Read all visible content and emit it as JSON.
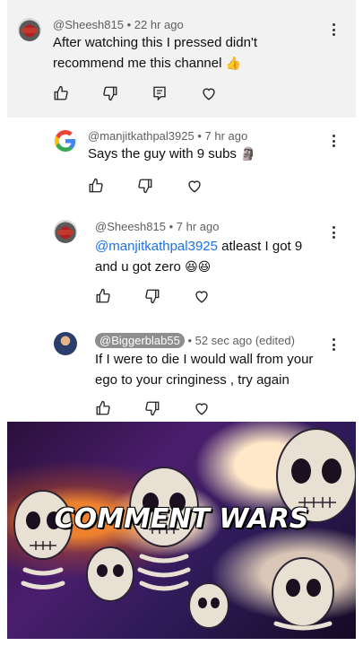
{
  "comments": [
    {
      "author": "@Sheesh815",
      "time": "22 hr ago",
      "text": "After watching this I pressed didn't recommend me this channel",
      "emoji": "👍"
    }
  ],
  "replies": [
    {
      "author": "@manjitkathpal3925",
      "time": "7 hr ago",
      "text": "Says the guy with 9 subs",
      "emoji": "🗿"
    },
    {
      "author": "@Sheesh815",
      "time": "7 hr ago",
      "mention": "@manjitkathpal3925",
      "text": " atleast I got 9 and u got zero",
      "emoji": "😆😆"
    },
    {
      "author": "@Biggerblab55",
      "time": "52 sec ago (edited)",
      "text": "If I were to die I would wall from your ego to your cringiness , try again"
    }
  ],
  "separator": " • ",
  "meme": {
    "caption": "COMMENT WARS"
  },
  "icons": {
    "like": "thumbs-up-icon",
    "dislike": "thumbs-down-icon",
    "reply": "reply-icon",
    "heart": "heart-icon",
    "more": "more-vert-icon"
  }
}
